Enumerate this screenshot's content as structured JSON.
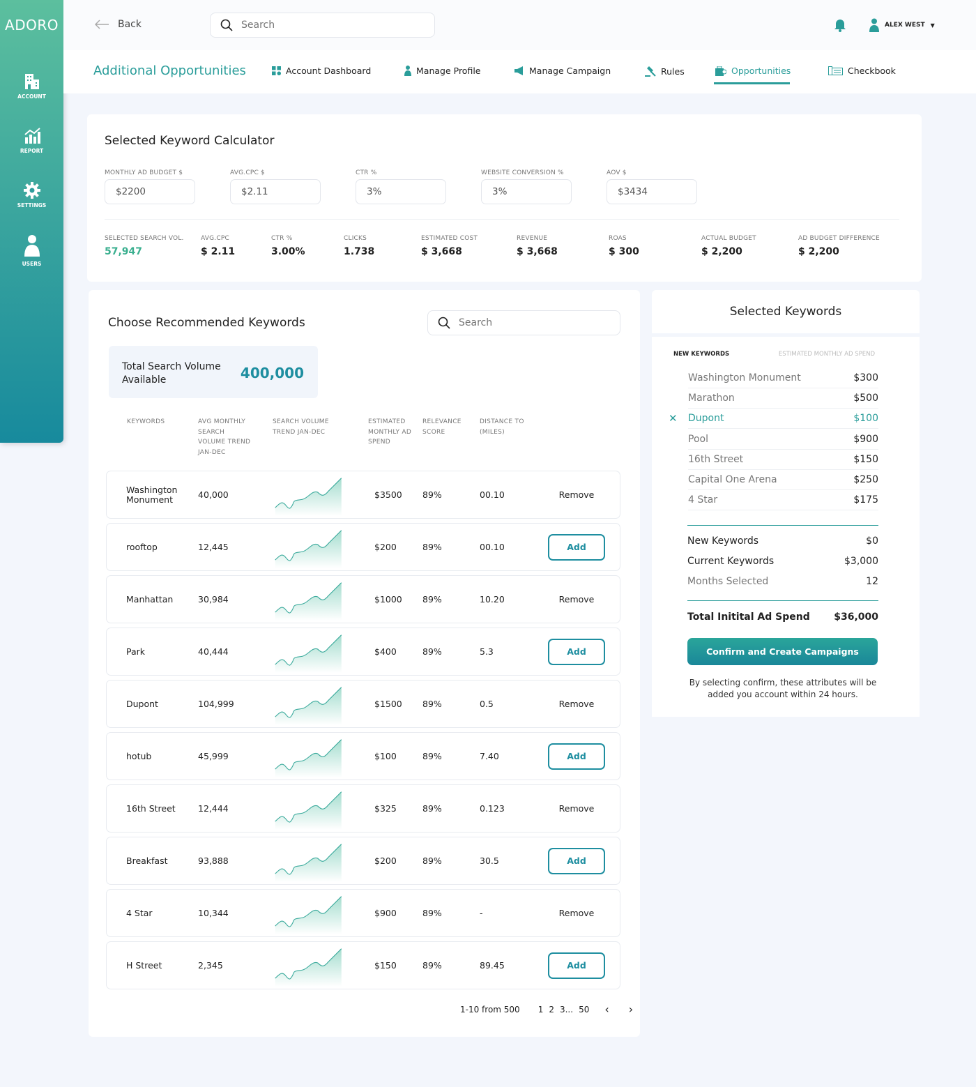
{
  "app": {
    "logo": "ADORO"
  },
  "sidebar": [
    {
      "label": "ACCOUNT",
      "icon": "building-icon"
    },
    {
      "label": "REPORT",
      "icon": "chart-icon"
    },
    {
      "label": "SETTINGS",
      "icon": "gear-icon"
    },
    {
      "label": "USERS",
      "icon": "user-icon"
    }
  ],
  "header": {
    "back": "Back",
    "search_placeholder": "Search",
    "user": "ALEX WEST"
  },
  "nav": {
    "title": "Additional Opportunities",
    "items": [
      {
        "label": "Account Dashboard",
        "icon": "grid-icon"
      },
      {
        "label": "Manage Profile",
        "icon": "person-icon"
      },
      {
        "label": "Manage Campaign",
        "icon": "megaphone-icon"
      },
      {
        "label": "Rules",
        "icon": "gavel-icon"
      },
      {
        "label": "Opportunities",
        "icon": "briefcase-icon",
        "active": true
      },
      {
        "label": "Checkbook",
        "icon": "checkbook-icon"
      }
    ]
  },
  "calculator": {
    "title": "Selected Keyword Calculator",
    "inputs": [
      {
        "label": "MONTHLY AD BUDGET $",
        "value": "$2200"
      },
      {
        "label": "AVG.CPC $",
        "value": "$2.11"
      },
      {
        "label": "CTR %",
        "value": "3%"
      },
      {
        "label": "WEBSITE CONVERSION %",
        "value": "3%"
      },
      {
        "label": "AOV $",
        "value": "$3434"
      }
    ],
    "stats": [
      {
        "label": "SELECTED SEARCH VOL.",
        "value": "57,947"
      },
      {
        "label": "AVG.CPC",
        "value": "$ 2.11"
      },
      {
        "label": "CTR %",
        "value": "3.00%"
      },
      {
        "label": "CLICKS",
        "value": "1.738"
      },
      {
        "label": "ESTIMATED COST",
        "value": "$ 3,668"
      },
      {
        "label": "REVENUE",
        "value": "$ 3,668"
      },
      {
        "label": "ROAS",
        "value": "$ 300"
      },
      {
        "label": "ACTUAL BUDGET",
        "value": "$ 2,200"
      },
      {
        "label": "AD BUDGET DIFFERENCE",
        "value": "$ 2,200"
      }
    ]
  },
  "recommended": {
    "title": "Choose Recommended Keywords",
    "search_placeholder": "Search",
    "total_label": "Total Search Volume Available",
    "total_value": "400,000",
    "columns": [
      "KEYWORDS",
      "AVG MONTHLY SEARCH VOLUME TREND JAN-DEC",
      "SEARCH VOLUME TREND JAN-DEC",
      "ESTIMATED MONTHLY AD SPEND",
      "RELEVANCE SCORE",
      "DISTANCE TO (MILES)"
    ],
    "rows": [
      {
        "keyword": "Washington Monument",
        "volume": "40,000",
        "spend": "$3500",
        "relevance": "89%",
        "distance": "00.10",
        "action": "Remove"
      },
      {
        "keyword": "rooftop",
        "volume": "12,445",
        "spend": "$200",
        "relevance": "89%",
        "distance": "00.10",
        "action": "Add"
      },
      {
        "keyword": "Manhattan",
        "volume": "30,984",
        "spend": "$1000",
        "relevance": "89%",
        "distance": "10.20",
        "action": "Remove"
      },
      {
        "keyword": "Park",
        "volume": "40,444",
        "spend": "$400",
        "relevance": "89%",
        "distance": "5.3",
        "action": "Add"
      },
      {
        "keyword": "Dupont",
        "volume": "104,999",
        "spend": "$1500",
        "relevance": "89%",
        "distance": "0.5",
        "action": "Remove"
      },
      {
        "keyword": "hotub",
        "volume": "45,999",
        "spend": "$100",
        "relevance": "89%",
        "distance": "7.40",
        "action": "Add"
      },
      {
        "keyword": "16th Street",
        "volume": "12,444",
        "spend": "$325",
        "relevance": "89%",
        "distance": "0.123",
        "action": "Remove"
      },
      {
        "keyword": "Breakfast",
        "volume": "93,888",
        "spend": "$200",
        "relevance": "89%",
        "distance": "30.5",
        "action": "Add"
      },
      {
        "keyword": "4 Star",
        "volume": "10,344",
        "spend": "$900",
        "relevance": "89%",
        "distance": "-",
        "action": "Remove"
      },
      {
        "keyword": "H Street",
        "volume": "2,345",
        "spend": "$150",
        "relevance": "89%",
        "distance": "89.45",
        "action": "Add"
      }
    ],
    "pagination": {
      "summary": "1-10 from 500",
      "pages": [
        "1",
        "2",
        "3...",
        "50"
      ]
    }
  },
  "selected": {
    "title": "Selected Keywords",
    "col1": "NEW KEYWORDS",
    "col2": "ESTIMATED MONTHLY AD SPEND",
    "items": [
      {
        "name": "Washington Monument",
        "amount": "$300"
      },
      {
        "name": "Marathon",
        "amount": "$500"
      },
      {
        "name": "Dupont",
        "amount": "$100",
        "highlight": true
      },
      {
        "name": "Pool",
        "amount": "$900"
      },
      {
        "name": "16th Street",
        "amount": "$150"
      },
      {
        "name": "Capital One Arena",
        "amount": "$250"
      },
      {
        "name": "4 Star",
        "amount": "$175"
      }
    ],
    "new_label": "New Keywords",
    "new_value": "$0",
    "current_label": "Current Keywords",
    "current_value": "$3,000",
    "months_label": "Months Selected",
    "months_value": "12",
    "total_label": "Total Initital Ad Spend",
    "total_value": "$36,000",
    "confirm": "Confirm and Create Campaigns",
    "note": "By selecting confirm, these attributes will be added you account within 24 hours."
  },
  "colors": {
    "accent": "#2a9d9a",
    "button": "#1e8ea0"
  }
}
